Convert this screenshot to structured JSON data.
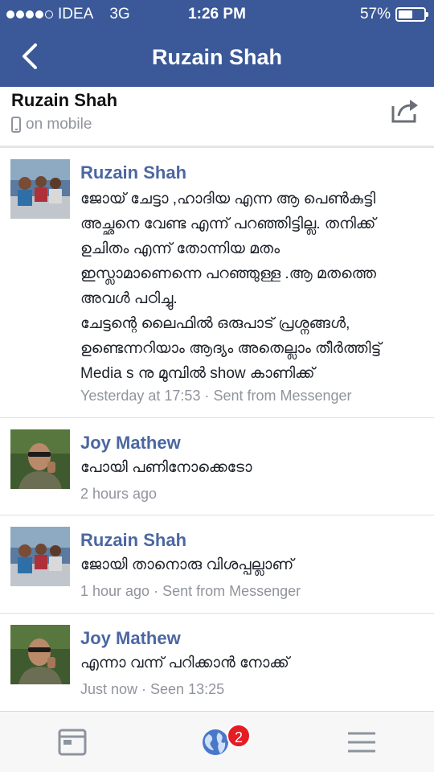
{
  "status_bar": {
    "carrier": "IDEA",
    "network": "3G",
    "time": "1:26 PM",
    "battery_percent": "57%",
    "battery_level": 0.57,
    "signal_dots_filled": 4,
    "signal_dots_total": 5
  },
  "nav": {
    "title": "Ruzain Shah",
    "back_icon": "chevron-left-icon"
  },
  "info": {
    "name": "Ruzain Shah",
    "status": "on mobile",
    "share_icon": "share-icon"
  },
  "messages": [
    {
      "sender": "Ruzain Shah",
      "lines": [
        "ജോയ് ചേട്ടാ ,ഹാദിയ എന്ന ആ പെൺകുട്ടി",
        "അച്ഛനെ വേണ്ട എന്ന് പറഞ്ഞിട്ടില്ല. തനിക്ക്",
        "ഉചിതം എന്ന് തോന്നിയ മതം",
        "ഇസ്ലാമാണെന്നെ പറഞ്ഞുള്ള .ആ മതത്തെ",
        "അവൾ പഠിച്ചു.",
        "ചേട്ടന്റെ ലൈഫിൽ ഒരുപാട് പ്രശ്നങ്ങൾ,",
        "ഉണ്ടെന്നറിയാം ആദ്യം അതെല്ലാം തീർത്തിട്ട്",
        "Media s നു മുമ്പിൽ show കാണിക്ക്"
      ],
      "meta": "Yesterday at 17:53 · Sent from Messenger"
    },
    {
      "sender": "Joy Mathew",
      "lines": [
        "പോയി പണിനോക്കെടോ"
      ],
      "meta": "2 hours ago"
    },
    {
      "sender": "Ruzain Shah",
      "lines": [
        "ജോയി താനൊരു വിശപ്പല്ലാണ്"
      ],
      "meta": "1 hour ago · Sent from Messenger"
    },
    {
      "sender": "Joy Mathew",
      "lines": [
        "എന്നാ വന്ന് പറിക്കാൻ നോക്ക്"
      ],
      "meta": "Just now · Seen 13:25"
    }
  ],
  "tabbar": {
    "tabs": [
      {
        "icon": "news-feed-icon"
      },
      {
        "icon": "globe-notifications-icon",
        "badge": "2"
      },
      {
        "icon": "menu-icon"
      }
    ]
  },
  "colors": {
    "brand": "#3b5998",
    "name_link": "#4b67a1",
    "meta_gray": "#90949c",
    "badge_red": "#e41c23"
  }
}
